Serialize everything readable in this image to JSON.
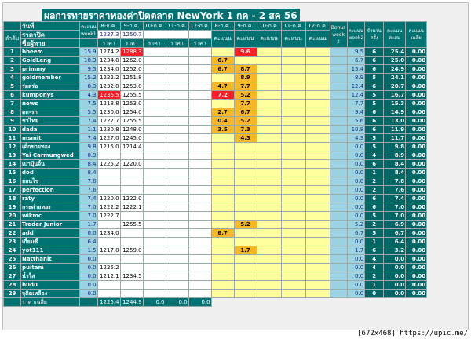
{
  "title": "ผลการทายราคาทองค่าปิดตลาด NewYork 1 กค - 2 สค 56",
  "colors": {
    "teal": "#007272",
    "light_blue": "#9bd3e3",
    "yellow": "#ffff9e",
    "gold": "#f7b825",
    "red": "#ff1d25"
  },
  "header": {
    "row1": {
      "date_label": "วันที่",
      "points_w1": "คะแนน week1",
      "d8": "8-ก.ค.",
      "d9": "9-ก.ค.",
      "d10": "10-ก.ค.",
      "d11": "11-ก.ค.",
      "d12": "12-ก.ค.",
      "s8": "8-ก.ค.",
      "s9": "9-ก.ค.",
      "s10": "10-ก.ค.",
      "s11": "11-ก.ค.",
      "s12": "12-ก.ค.",
      "bonus": "Bonus week 2",
      "points_w2": "คะแนน week2",
      "count": "จำนวนครั้ง",
      "accum": "คะแนนสะสม",
      "avg_score": "คะแนนเฉลี่ย"
    },
    "row2": {
      "close_label": "ราคาปิด",
      "close8": "1237.3",
      "close9": "1250.7"
    },
    "row3": {
      "idx": "ลำดับ",
      "name_label": "ชื่อผู้ทาย",
      "price": "ราคา",
      "score1": "คะแนน",
      "score2": "คะแนน",
      "score3": "คะแนน",
      "score4": "คะแนน",
      "score5": "คะแนน"
    }
  },
  "rows": [
    {
      "n": "1",
      "name": "bbeem",
      "w1": "15.9",
      "p8": "1274.2",
      "p9": "1288.3",
      "s8": "",
      "s9": "9.6",
      "bonus": "",
      "w2": "9.5",
      "cnt": "6",
      "acc": "25.4",
      "avg": "0.00"
    },
    {
      "n": "2",
      "name": "GoldLeng",
      "w1": "18.3",
      "p8": "1234.0",
      "p9": "1262.0",
      "s8": "6.7",
      "s9": "",
      "bonus": "",
      "w2": "6.7",
      "cnt": "6",
      "acc": "25.0",
      "avg": "0.00"
    },
    {
      "n": "3",
      "name": "primmy",
      "w1": "9.5",
      "p8": "1234.0",
      "p9": "1252.0",
      "s8": "6.7",
      "s9": "8.7",
      "bonus": "",
      "w2": "15.4",
      "cnt": "6",
      "acc": "24.9",
      "avg": "0.00"
    },
    {
      "n": "4",
      "name": "goldmember",
      "w1": "15.2",
      "p8": "1222.2",
      "p9": "1251.8",
      "s8": "",
      "s9": "8.9",
      "bonus": "",
      "w2": "8.9",
      "cnt": "5",
      "acc": "24.1",
      "avg": "0.00"
    },
    {
      "n": "5",
      "name": "ร่อสร่อ",
      "w1": "8.3",
      "p8": "1232.0",
      "p9": "1253.0",
      "s8": "4.7",
      "s9": "7.7",
      "bonus": "",
      "w2": "12.4",
      "cnt": "6",
      "acc": "20.7",
      "avg": "0.00"
    },
    {
      "n": "6",
      "name": "kumponys",
      "w1": "4.3",
      "p8": "1236.5",
      "p9": "1255.5",
      "s8": "7.2",
      "s9": "5.2",
      "bonus": "",
      "w2": "12.4",
      "cnt": "5",
      "acc": "16.7",
      "avg": "0.00"
    },
    {
      "n": "7",
      "name": "news",
      "w1": "7.5",
      "p8": "1218.8",
      "p9": "1253.0",
      "s8": "",
      "s9": "7.7",
      "bonus": "",
      "w2": "7.7",
      "cnt": "5",
      "acc": "15.3",
      "avg": "0.00"
    },
    {
      "n": "8",
      "name": "ตก-รก",
      "w1": "5.5",
      "p8": "1230.0",
      "p9": "1254.0",
      "s8": "2.7",
      "s9": "6.7",
      "bonus": "",
      "w2": "9.4",
      "cnt": "6",
      "acc": "14.9",
      "avg": "0.00"
    },
    {
      "n": "9",
      "name": "ชาไทย",
      "w1": "7.4",
      "p8": "1227.7",
      "p9": "1255.5",
      "s8": "0.4",
      "s9": "5.2",
      "bonus": "",
      "w2": "5.6",
      "cnt": "6",
      "acc": "13.0",
      "avg": "0.00"
    },
    {
      "n": "10",
      "name": "dada",
      "w1": "1.1",
      "p8": "1230.8",
      "p9": "1248.0",
      "s8": "3.5",
      "s9": "7.3",
      "bonus": "",
      "w2": "10.8",
      "cnt": "6",
      "acc": "11.9",
      "avg": "0.00"
    },
    {
      "n": "11",
      "name": "msmit",
      "w1": "7.4",
      "p8": "1227.0",
      "p9": "1245.0",
      "s8": "",
      "s9": "4.3",
      "bonus": "",
      "w2": "4.3",
      "cnt": "5",
      "acc": "11.7",
      "avg": "0.00"
    },
    {
      "n": "12",
      "name": "เด็กขายทอง",
      "w1": "9.8",
      "p8": "1215.0",
      "p9": "1214.4",
      "s8": "",
      "s9": "",
      "bonus": "",
      "w2": "0.0",
      "cnt": "5",
      "acc": "9.8",
      "avg": "0.00"
    },
    {
      "n": "13",
      "name": "Yai Carmungwed",
      "w1": "8.9",
      "p8": "",
      "p9": "",
      "s8": "",
      "s9": "",
      "bonus": "",
      "w2": "0.0",
      "cnt": "4",
      "acc": "8.9",
      "avg": "0.00"
    },
    {
      "n": "14",
      "name": "เปาบุ้นจิ้น",
      "w1": "8.4",
      "p8": "1225.2",
      "p9": "1220.0",
      "s8": "",
      "s9": "",
      "bonus": "",
      "w2": "0.0",
      "cnt": "6",
      "acc": "8.4",
      "avg": "0.00"
    },
    {
      "n": "15",
      "name": "dod",
      "w1": "8.4",
      "p8": "",
      "p9": "",
      "s8": "",
      "s9": "",
      "bonus": "",
      "w2": "0.0",
      "cnt": "1",
      "acc": "8.4",
      "avg": "0.00"
    },
    {
      "n": "16",
      "name": "ยอนไช",
      "w1": "7.8",
      "p8": "",
      "p9": "",
      "s8": "",
      "s9": "",
      "bonus": "",
      "w2": "0.0",
      "cnt": "2",
      "acc": "7.8",
      "avg": "0.00"
    },
    {
      "n": "17",
      "name": "perfection",
      "w1": "7.6",
      "p8": "",
      "p9": "",
      "s8": "",
      "s9": "",
      "bonus": "",
      "w2": "0.0",
      "cnt": "2",
      "acc": "7.6",
      "avg": "0.00"
    },
    {
      "n": "18",
      "name": "raty",
      "w1": "7.4",
      "p8": "1220.0",
      "p9": "1222.0",
      "s8": "",
      "s9": "",
      "bonus": "",
      "w2": "0.0",
      "cnt": "6",
      "acc": "7.4",
      "avg": "0.00"
    },
    {
      "n": "19",
      "name": "กระต่ายทอง",
      "w1": "7.0",
      "p8": "1222.2",
      "p9": "1222.1",
      "s8": "",
      "s9": "",
      "bonus": "",
      "w2": "0.0",
      "cnt": "6",
      "acc": "7.0",
      "avg": "0.00"
    },
    {
      "n": "20",
      "name": "wikmc",
      "w1": "7.0",
      "p8": "1222.7",
      "p9": "",
      "s8": "",
      "s9": "",
      "bonus": "",
      "w2": "0.0",
      "cnt": "5",
      "acc": "7.0",
      "avg": "0.00"
    },
    {
      "n": "21",
      "name": "Trader Junior",
      "w1": "1.7",
      "p8": "",
      "p9": "1255.5",
      "s8": "",
      "s9": "5.2",
      "bonus": "",
      "w2": "5.2",
      "cnt": "2",
      "acc": "6.9",
      "avg": "0.00"
    },
    {
      "n": "22",
      "name": "add",
      "w1": "0.0",
      "p8": "1234.0",
      "p9": "",
      "s8": "6.7",
      "s9": "",
      "bonus": "",
      "w2": "6.7",
      "cnt": "5",
      "acc": "6.7",
      "avg": "0.00"
    },
    {
      "n": "23",
      "name": "เกี้ยมซี้",
      "w1": "6.4",
      "p8": "",
      "p9": "",
      "s8": "",
      "s9": "",
      "bonus": "",
      "w2": "0.0",
      "cnt": "1",
      "acc": "6.4",
      "avg": "0.00"
    },
    {
      "n": "24",
      "name": "yot111",
      "w1": "1.5",
      "p8": "1217.0",
      "p9": "1259.0",
      "s8": "",
      "s9": "1.7",
      "bonus": "",
      "w2": "1.7",
      "cnt": "6",
      "acc": "3.2",
      "avg": "0.00"
    },
    {
      "n": "25",
      "name": "Natthanit",
      "w1": "0.0",
      "p8": "",
      "p9": "",
      "s8": "",
      "s9": "",
      "bonus": "",
      "w2": "0.0",
      "cnt": "4",
      "acc": "0.0",
      "avg": "0.00"
    },
    {
      "n": "26",
      "name": "puitam",
      "w1": "0.0",
      "p8": "1225.2",
      "p9": "",
      "s8": "",
      "s9": "",
      "bonus": "",
      "w2": "0.0",
      "cnt": "4",
      "acc": "0.0",
      "avg": "0.00"
    },
    {
      "n": "27",
      "name": "น้ำใส",
      "w1": "0.0",
      "p8": "1212.1",
      "p9": "1234.5",
      "s8": "",
      "s9": "",
      "bonus": "",
      "w2": "0.0",
      "cnt": "2",
      "acc": "0.0",
      "avg": "0.00"
    },
    {
      "n": "28",
      "name": "budu",
      "w1": "0.0",
      "p8": "",
      "p9": "",
      "s8": "",
      "s9": "",
      "bonus": "",
      "w2": "0.0",
      "cnt": "1",
      "acc": "0.0",
      "avg": "0.00"
    },
    {
      "n": "29",
      "name": "จุติดเหลือง",
      "w1": "0.0",
      "p8": "",
      "p9": "",
      "s8": "",
      "s9": "",
      "bonus": "",
      "w2": "0.0",
      "cnt": "0",
      "acc": "0.0",
      "avg": "0.00"
    }
  ],
  "footer": {
    "label": "ราคาเฉลี่ย",
    "a8": "1225.4",
    "a9": "1244.9",
    "a10": "0.0",
    "a11": "0.0",
    "a12": "0.0"
  },
  "watermark": "[672x468] https://upic.me/"
}
